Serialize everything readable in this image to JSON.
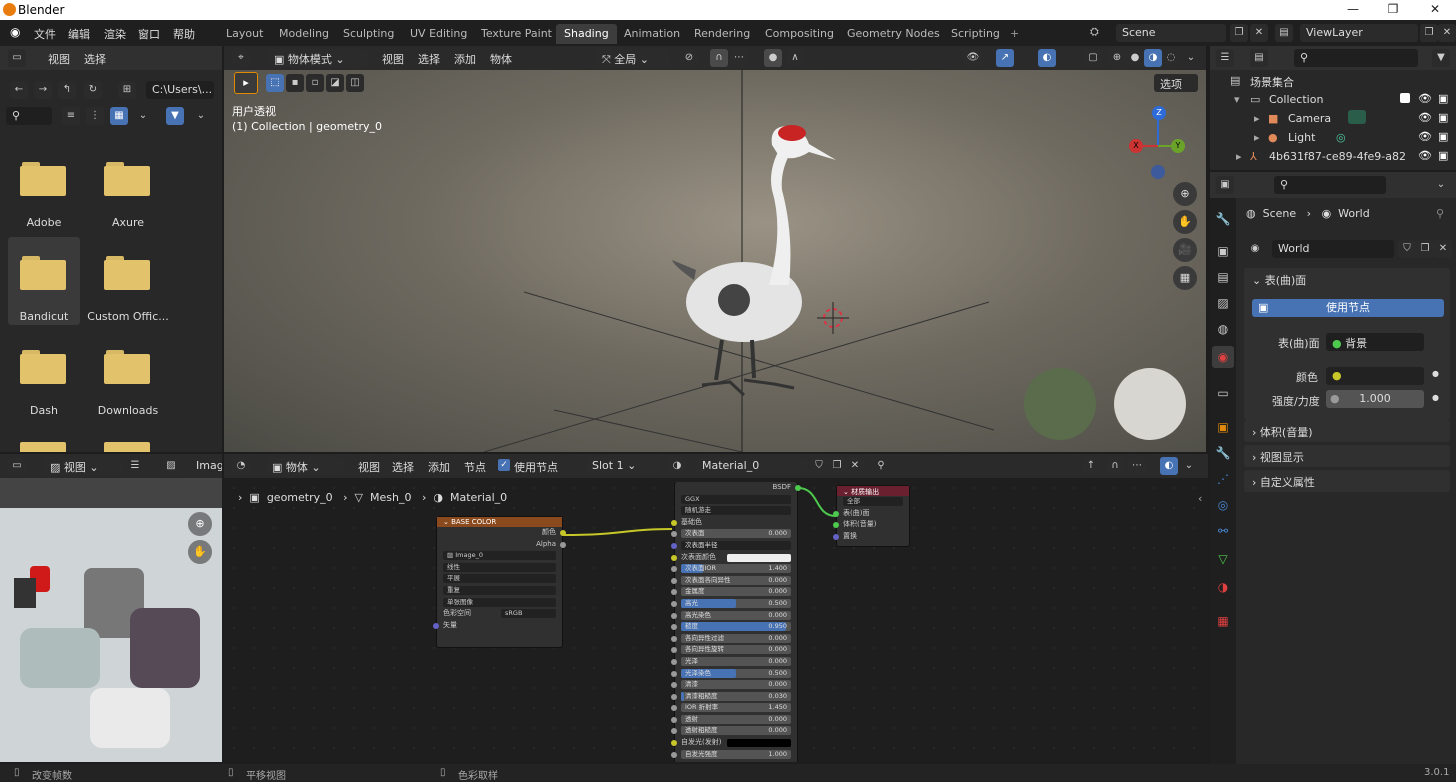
{
  "window": {
    "title": "Blender"
  },
  "menu": [
    "文件",
    "编辑",
    "渲染",
    "窗口",
    "帮助"
  ],
  "workspaces": [
    "Layout",
    "Modeling",
    "Sculpting",
    "UV Editing",
    "Texture Paint",
    "Shading",
    "Animation",
    "Rendering",
    "Compositing",
    "Geometry Nodes",
    "Scripting"
  ],
  "active_workspace": "Shading",
  "scene": {
    "name": "Scene",
    "view_layer": "ViewLayer"
  },
  "file_browser": {
    "menu": [
      "视图",
      "选择"
    ],
    "path": "C:\\Users\\...",
    "folders": [
      "Adobe",
      "Axure",
      "Bandicut",
      "Custom Offic...",
      "Dash",
      "Downloads"
    ],
    "selected": "Bandicut"
  },
  "viewport": {
    "mode": "物体模式",
    "menu": [
      "视图",
      "选择",
      "添加",
      "物体"
    ],
    "transform": "全局",
    "options": "选项",
    "view_name": "用户透视",
    "collection_info": "(1) Collection | geometry_0",
    "gizmo": {
      "z": "Z",
      "y": "Y",
      "x": "X"
    }
  },
  "image_editor": {
    "view": "视图",
    "image_label": "Imag"
  },
  "node_editor": {
    "object_mode": "物体",
    "menu": [
      "视图",
      "选择",
      "添加",
      "节点"
    ],
    "use_nodes": "使用节点",
    "slot": "Slot 1",
    "material": "Material_0",
    "breadcrumb": [
      "geometry_0",
      "Mesh_0",
      "Material_0"
    ],
    "image_node": {
      "title": "BASE COLOR",
      "out_color": "颜色",
      "out_alpha": "Alpha",
      "image": "Image_0",
      "interp": "线性",
      "proj": "平展",
      "ext": "重复",
      "source": "单张图像",
      "colorspace_label": "色彩空间",
      "colorspace": "sRGB",
      "vector": "矢量"
    },
    "bsdf": {
      "title": "BSDF",
      "distribution": "GGX",
      "sss_method": "随机游走",
      "base_color": "基础色",
      "rows": [
        {
          "label": "次表面",
          "value": "0.000",
          "fill": 0
        },
        {
          "label": "次表面半径",
          "value": "",
          "fill": 0
        },
        {
          "label": "次表面颜色",
          "value": "",
          "fill": 0
        },
        {
          "label": "次表面IOR",
          "value": "1.400",
          "fill": 0.2
        },
        {
          "label": "次表面各向异性",
          "value": "0.000",
          "fill": 0
        },
        {
          "label": "金属度",
          "value": "0.000",
          "fill": 0
        },
        {
          "label": "高光",
          "value": "0.500",
          "fill": 0.5
        },
        {
          "label": "高光染色",
          "value": "0.000",
          "fill": 0
        },
        {
          "label": "糙度",
          "value": "0.950",
          "fill": 0.95
        },
        {
          "label": "各向异性过滤",
          "value": "0.000",
          "fill": 0
        },
        {
          "label": "各向异性旋转",
          "value": "0.000",
          "fill": 0
        },
        {
          "label": "光泽",
          "value": "0.000",
          "fill": 0
        },
        {
          "label": "光泽染色",
          "value": "0.500",
          "fill": 0.5
        },
        {
          "label": "清漆",
          "value": "0.000",
          "fill": 0
        },
        {
          "label": "清漆粗糙度",
          "value": "0.030",
          "fill": 0.03
        },
        {
          "label": "IOR 折射率",
          "value": "1.450",
          "fill": 0
        },
        {
          "label": "透射",
          "value": "0.000",
          "fill": 0
        },
        {
          "label": "透射粗糙度",
          "value": "0.000",
          "fill": 0
        },
        {
          "label": "自发光(发射)",
          "value": "",
          "fill": 0
        },
        {
          "label": "自发光强度",
          "value": "1.000",
          "fill": 0
        }
      ]
    },
    "output": {
      "title": "材质输出",
      "target": "全部",
      "inputs": [
        "表(曲)面",
        "体积(音量)",
        "置换"
      ]
    }
  },
  "outliner": {
    "root": "场景集合",
    "items": [
      {
        "name": "Collection",
        "level": 1
      },
      {
        "name": "Camera",
        "level": 2
      },
      {
        "name": "Light",
        "level": 2
      },
      {
        "name": "4b631f87-ce89-4fe9-a82",
        "level": 1
      }
    ]
  },
  "properties": {
    "breadcrumb": [
      "Scene",
      "World"
    ],
    "world": "World",
    "surface_panel": "表(曲)面",
    "use_nodes": "使用节点",
    "surface_label": "表(曲)面",
    "surface_value": "背景",
    "color_label": "颜色",
    "strength_label": "强度/力度",
    "strength_value": "1.000",
    "collapsed": [
      "体积(音量)",
      "视图显示",
      "自定义属性"
    ]
  },
  "status": {
    "left": "改变帧数",
    "mid": "平移视图",
    "right": "色彩取样",
    "version": "3.0.1"
  }
}
